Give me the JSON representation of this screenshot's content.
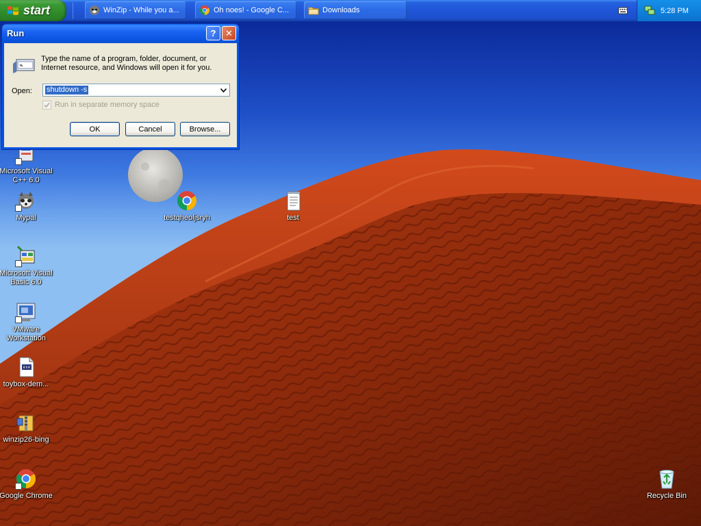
{
  "taskbar": {
    "start_label": "start",
    "tasks": [
      {
        "label": "WinZip - While you a...",
        "icon": "winzip-icon"
      },
      {
        "label": "Oh noes! - Google C...",
        "icon": "chrome-icon"
      },
      {
        "label": "Downloads",
        "icon": "folder-icon"
      }
    ],
    "tray": {
      "keyboard_icon": "keyboard-icon",
      "network_icon": "network-icon",
      "clock": "5:28 PM"
    }
  },
  "desktop": {
    "icons": [
      {
        "label": "Microsoft Visual C++ 6.0",
        "icon": "visual-cpp-icon"
      },
      {
        "label": "Mypal",
        "icon": "mypal-icon"
      },
      {
        "label": "Microsoft Visual Basic 6.0",
        "icon": "visual-basic-icon"
      },
      {
        "label": "VMware Workstation",
        "icon": "vmware-icon"
      },
      {
        "label": "toybox-dem...",
        "icon": "file-icon"
      },
      {
        "label": "winzip26-bing",
        "icon": "winzip-icon"
      },
      {
        "label": "Google Chrome",
        "icon": "chrome-icon"
      },
      {
        "label": "testqheoljsryh",
        "icon": "chrome-icon"
      },
      {
        "label": "test",
        "icon": "text-file-icon"
      },
      {
        "label": "Recycle Bin",
        "icon": "recycle-bin-icon"
      }
    ]
  },
  "run_dialog": {
    "title": "Run",
    "help_label": "?",
    "close_label": "✕",
    "description": "Type the name of a program, folder, document, or Internet resource, and Windows will open it for you.",
    "open_label": "Open:",
    "open_value": "shutdown -s",
    "separate_memory_label": "Run in separate memory space",
    "separate_memory_checked": true,
    "ok_label": "OK",
    "cancel_label": "Cancel",
    "browse_label": "Browse..."
  },
  "colors": {
    "taskbar_blue": "#245edb",
    "start_green": "#3c9a35",
    "tray_blue": "#0f81de",
    "dialog_face": "#ece9d8",
    "selection": "#316ac5"
  }
}
